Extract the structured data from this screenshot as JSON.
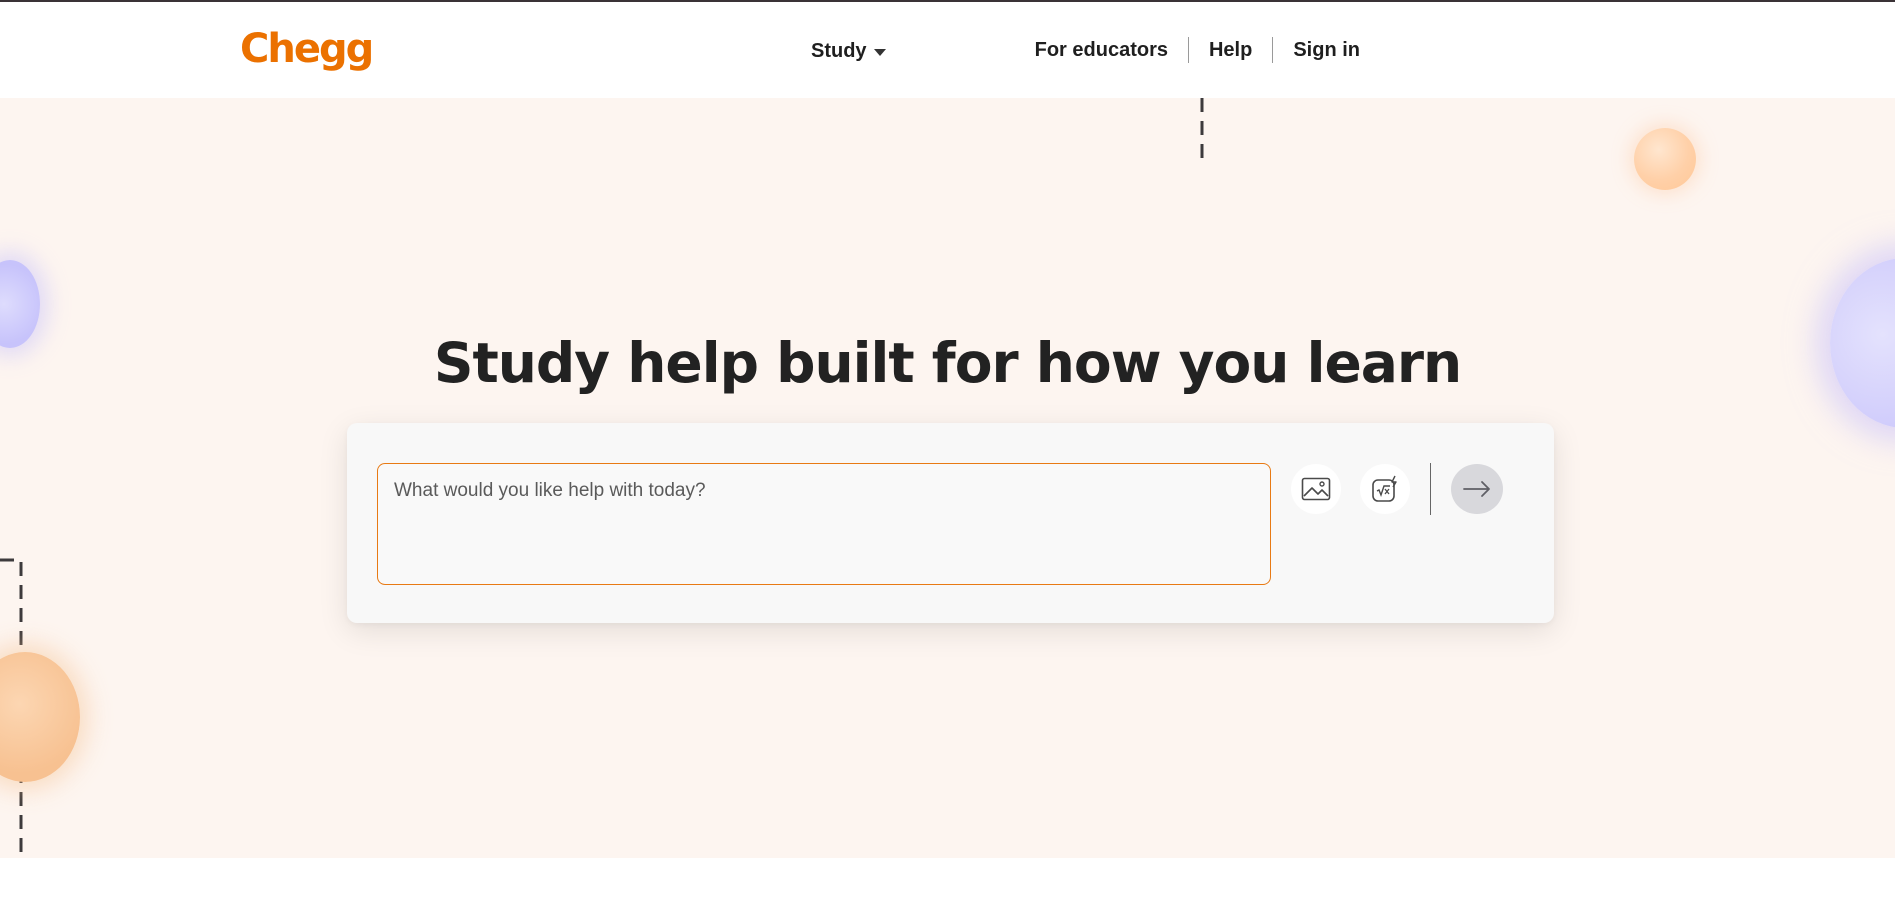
{
  "brand": {
    "logo_text": "Chegg",
    "accent_color": "#eb7100"
  },
  "header": {
    "study_menu_label": "Study",
    "nav": {
      "educators_label": "For educators",
      "help_label": "Help",
      "sign_in_label": "Sign in"
    }
  },
  "hero": {
    "headline": "Study help built for how you learn",
    "background_color": "#fdf5f0",
    "search": {
      "placeholder": "What would you like help with today?",
      "value": "",
      "image_upload_icon": "image-icon",
      "math_input_icon": "math-sqrt-icon",
      "submit_icon": "arrow-right-icon"
    }
  }
}
